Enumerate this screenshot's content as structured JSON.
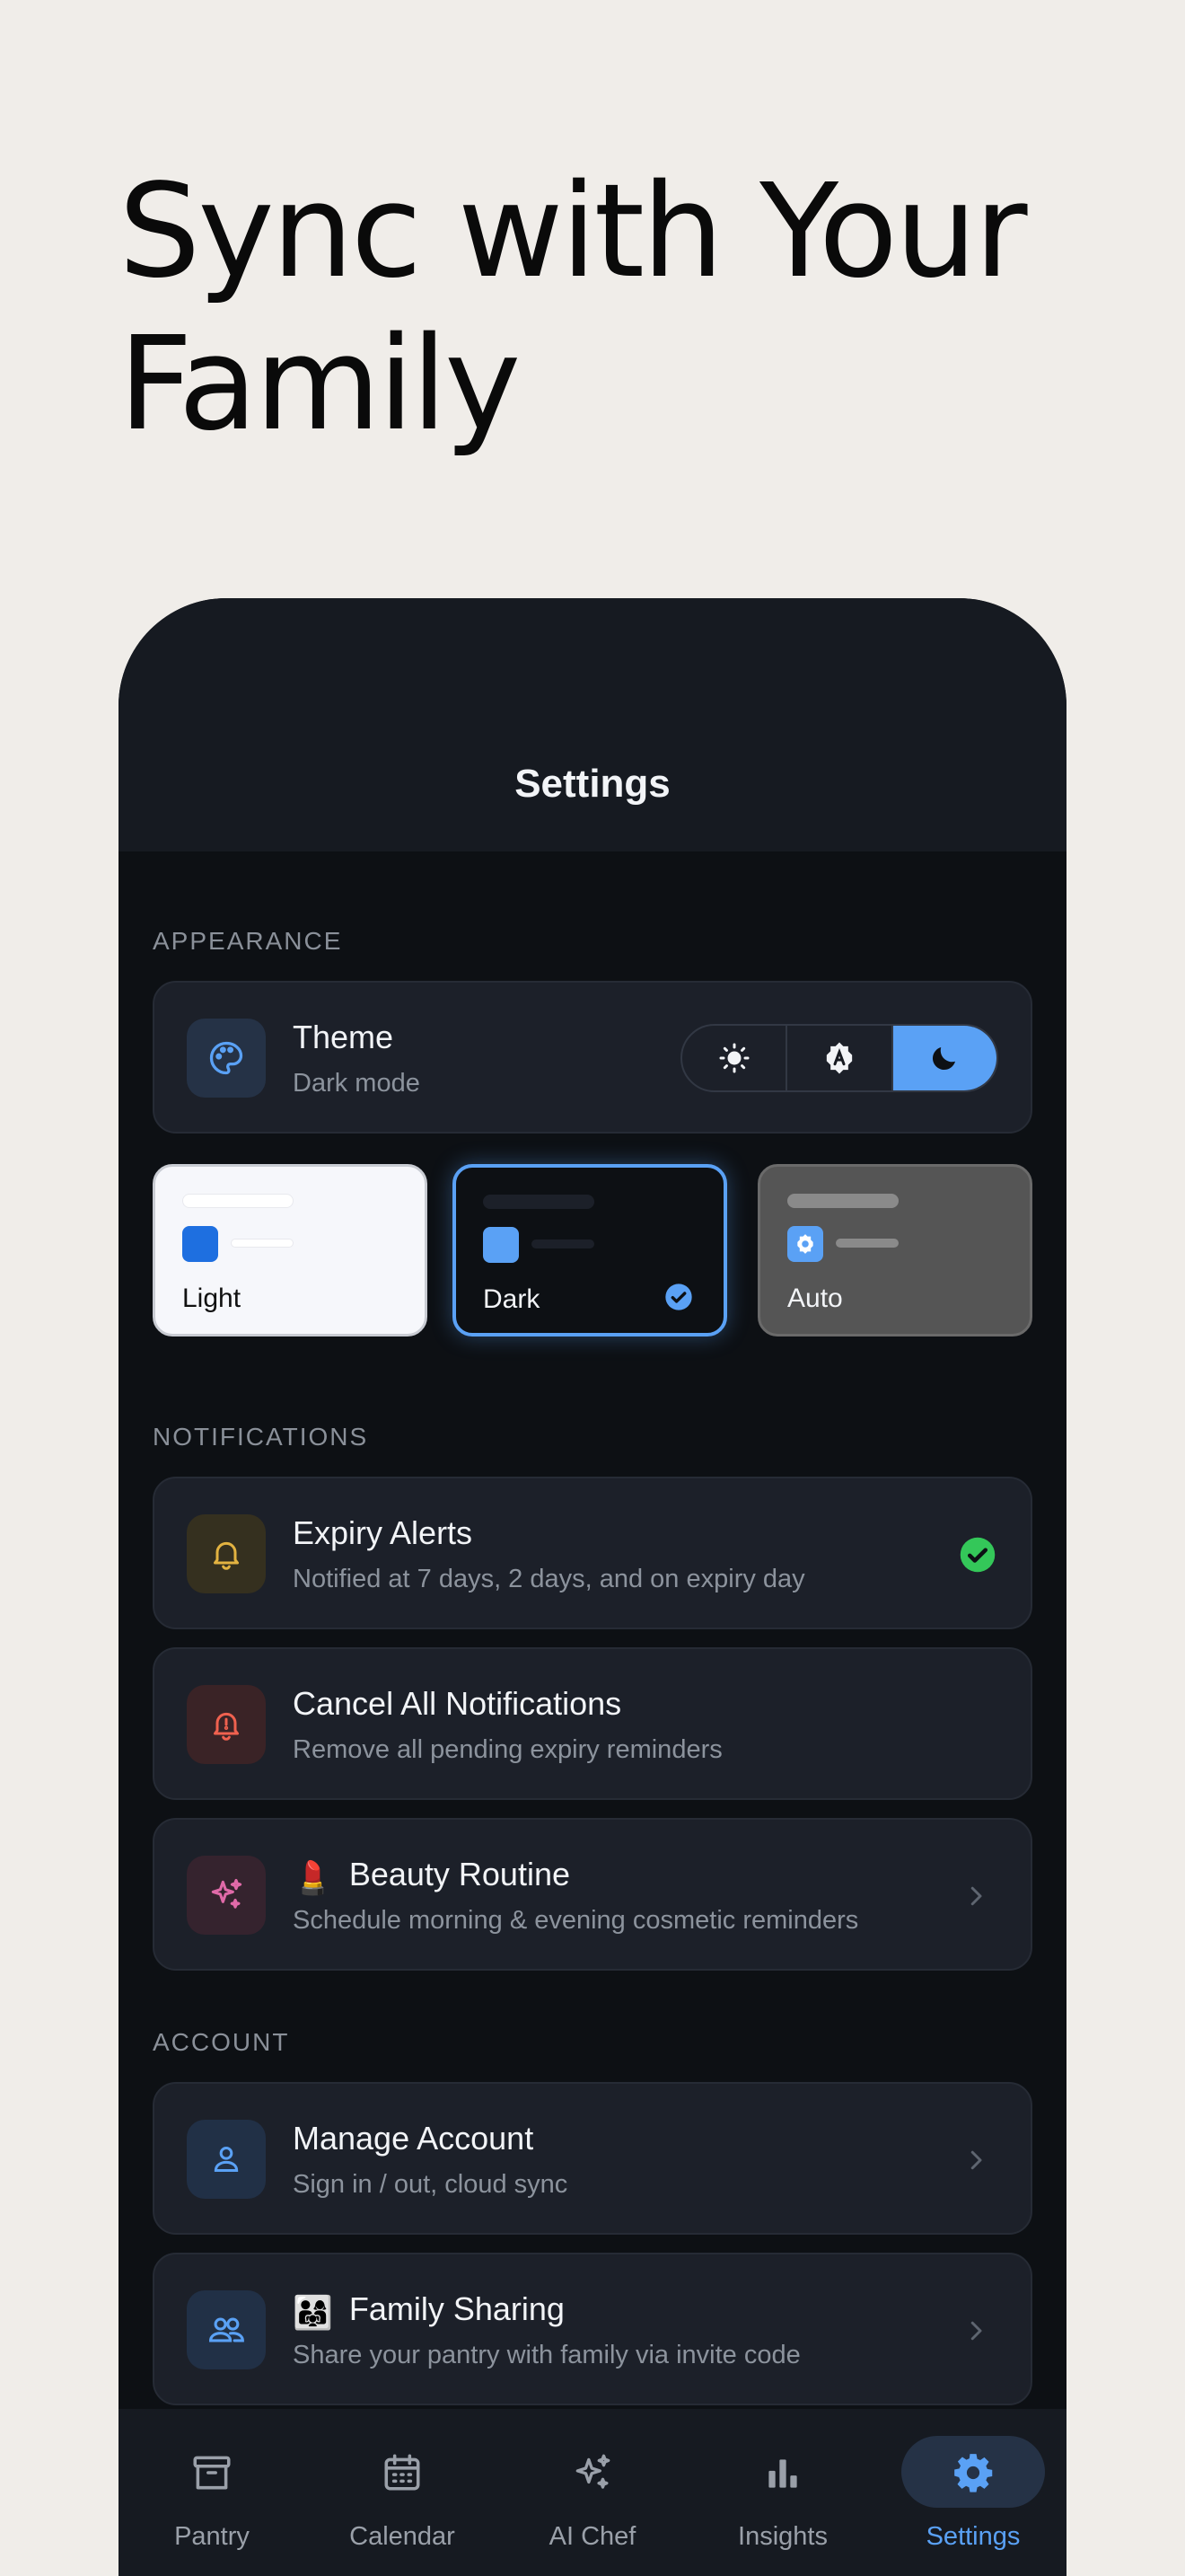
{
  "headline": {
    "line1": "Sync with Your",
    "line2": "Family"
  },
  "screen": {
    "title": "Settings"
  },
  "appearance": {
    "label": "APPEARANCE",
    "theme": {
      "title": "Theme",
      "subtitle": "Dark mode",
      "options": [
        "light",
        "auto",
        "dark"
      ],
      "selected": "dark"
    },
    "tiles": [
      {
        "label": "Light",
        "selected": false
      },
      {
        "label": "Dark",
        "selected": true
      },
      {
        "label": "Auto",
        "selected": false
      }
    ]
  },
  "notifications": {
    "label": "NOTIFICATIONS",
    "items": [
      {
        "title": "Expiry Alerts",
        "subtitle": "Notified at 7 days, 2 days, and on expiry day",
        "icon": "bell-icon",
        "trailing": "check"
      },
      {
        "title": "Cancel All Notifications",
        "subtitle": "Remove all pending expiry reminders",
        "icon": "bell-alert-icon",
        "trailing": "none"
      },
      {
        "title": "Beauty Routine",
        "subtitle": "Schedule morning & evening cosmetic reminders",
        "icon": "sparkles-icon",
        "prefix": "💄",
        "trailing": "chevron"
      }
    ]
  },
  "account": {
    "label": "ACCOUNT",
    "items": [
      {
        "title": "Manage Account",
        "subtitle": "Sign in / out, cloud sync",
        "icon": "user-icon",
        "trailing": "chevron"
      },
      {
        "title": "Family Sharing",
        "subtitle": "Share your pantry with family via invite code",
        "icon": "users-icon",
        "prefix": "👨‍👩‍👧",
        "trailing": "chevron"
      }
    ]
  },
  "tabs": [
    {
      "label": "Pantry",
      "icon": "archive-box-icon",
      "active": false
    },
    {
      "label": "Calendar",
      "icon": "calendar-icon",
      "active": false
    },
    {
      "label": "AI Chef",
      "icon": "sparkles-icon",
      "active": false
    },
    {
      "label": "Insights",
      "icon": "bar-chart-icon",
      "active": false
    },
    {
      "label": "Settings",
      "icon": "gear-icon",
      "active": true
    }
  ],
  "colors": {
    "accent": "#5aa1f5",
    "background": "#0d1014",
    "card": "#1c2029",
    "success": "#34c759",
    "warning": "#e3b341",
    "danger": "#f0614f",
    "pink": "#e06aa8"
  }
}
